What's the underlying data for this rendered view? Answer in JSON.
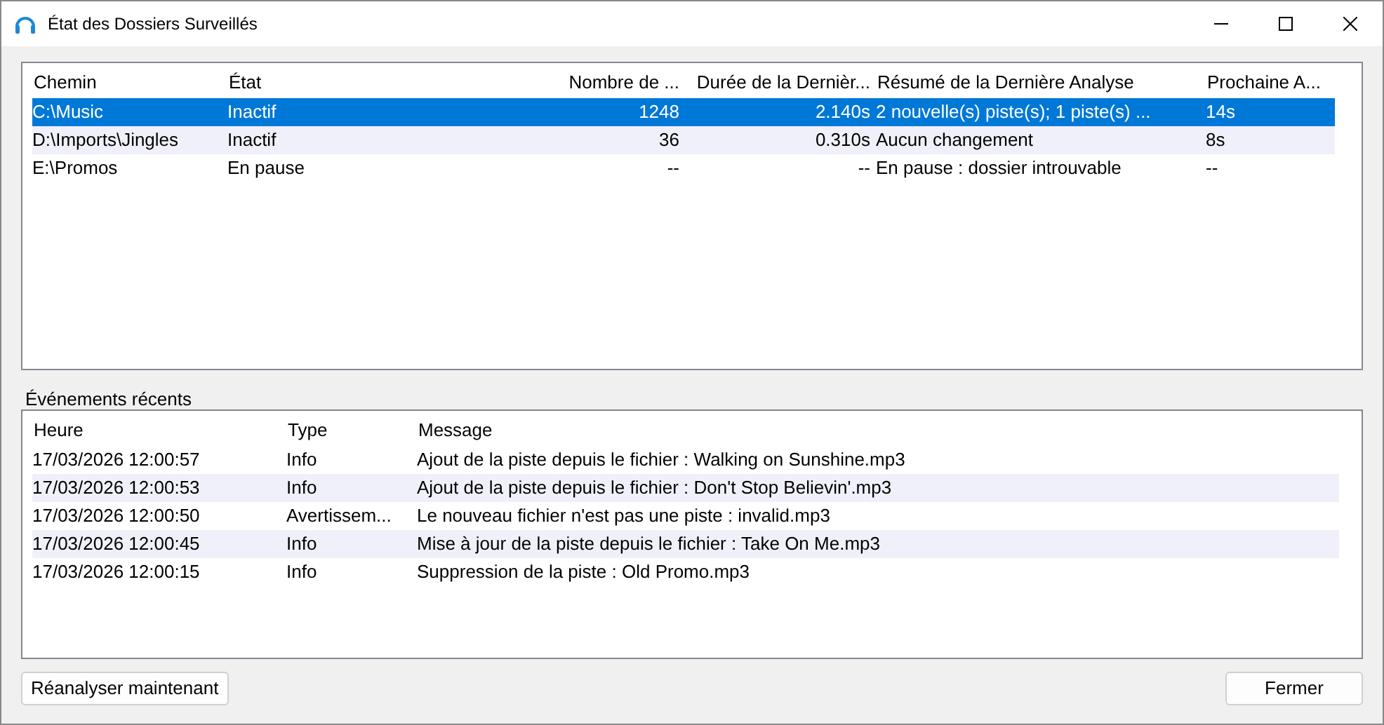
{
  "window": {
    "title": "État des Dossiers Surveillés"
  },
  "folders": {
    "columns": [
      {
        "label": "Chemin",
        "numeric": false
      },
      {
        "label": "État",
        "numeric": false
      },
      {
        "label": "Nombre de ...",
        "numeric": true
      },
      {
        "label": "Durée de la Dernièr...",
        "numeric": true
      },
      {
        "label": "Résumé de la Dernière Analyse",
        "numeric": false
      },
      {
        "label": "Prochaine A...",
        "numeric": false
      }
    ],
    "rows": [
      {
        "selected": true,
        "cells": [
          "C:\\Music",
          "Inactif",
          "1248",
          "2.140s",
          "2 nouvelle(s) piste(s); 1 piste(s) ...",
          "14s"
        ]
      },
      {
        "selected": false,
        "cells": [
          "D:\\Imports\\Jingles",
          "Inactif",
          "36",
          "0.310s",
          "Aucun changement",
          "8s"
        ]
      },
      {
        "selected": false,
        "cells": [
          "E:\\Promos",
          "En pause",
          "--",
          "--",
          "En pause : dossier introuvable",
          "--"
        ]
      }
    ]
  },
  "events": {
    "label": "Événements récents",
    "columns": [
      {
        "label": "Heure",
        "numeric": false
      },
      {
        "label": "Type",
        "numeric": false
      },
      {
        "label": "Message",
        "numeric": false
      }
    ],
    "rows": [
      {
        "selected": false,
        "cells": [
          "17/03/2026 12:00:57",
          "Info",
          "Ajout de la piste depuis le fichier : Walking on Sunshine.mp3"
        ]
      },
      {
        "selected": false,
        "cells": [
          "17/03/2026 12:00:53",
          "Info",
          "Ajout de la piste depuis le fichier : Don't Stop Believin'.mp3"
        ]
      },
      {
        "selected": false,
        "cells": [
          "17/03/2026 12:00:50",
          "Avertissem...",
          "Le nouveau fichier n'est pas une piste : invalid.mp3"
        ]
      },
      {
        "selected": false,
        "cells": [
          "17/03/2026 12:00:45",
          "Info",
          "Mise à jour de la piste depuis le fichier : Take On Me.mp3"
        ]
      },
      {
        "selected": false,
        "cells": [
          "17/03/2026 12:00:15",
          "Info",
          "Suppression de la piste : Old Promo.mp3"
        ]
      }
    ]
  },
  "buttons": {
    "rescan": "Réanalyser maintenant",
    "close": "Fermer"
  }
}
